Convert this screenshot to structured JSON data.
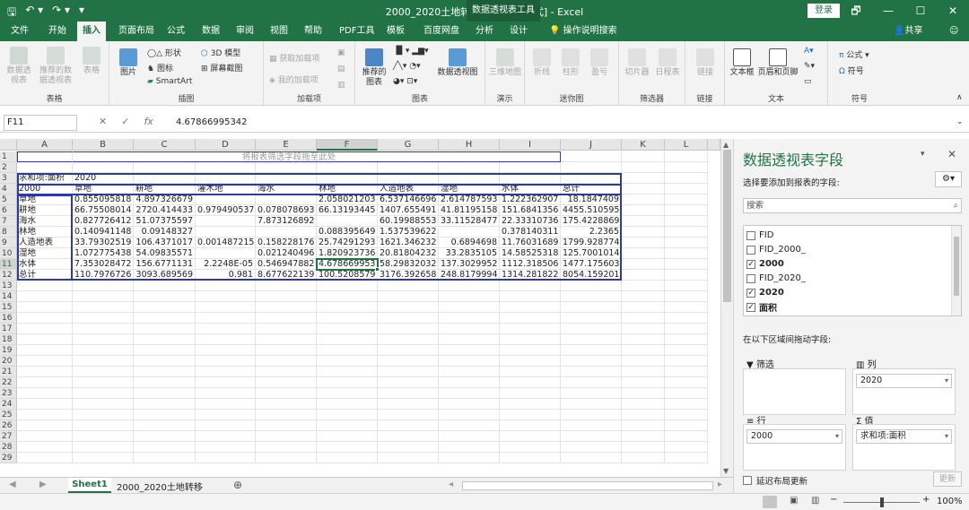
{
  "title": {
    "quick_access": [
      "🖫",
      "↶ ▾",
      "↷ ▾",
      "▾"
    ],
    "window": "2000_2020土地转移.xls [兼容模式] - Excel",
    "context": "数据透视表工具",
    "login": "登录",
    "controls": [
      "🗗",
      "—",
      "☐",
      "✕"
    ]
  },
  "tabs": [
    "文件",
    "开始",
    "插入",
    "页面布局",
    "公式",
    "数据",
    "审阅",
    "视图",
    "帮助",
    "PDF工具",
    "模板",
    "百度网盘",
    "分析",
    "设计",
    "操作说明搜索"
  ],
  "share": "共享",
  "ribbon": {
    "tables": {
      "label": "表格",
      "items": [
        "数据透视表",
        "推荐的数据透视表",
        "表格"
      ]
    },
    "illus": {
      "label": "插图",
      "picture": "图片",
      "shapes": "形状",
      "icons": "图标",
      "smartart": "SmartArt",
      "model3d": "3D 模型",
      "screenshot": "屏幕截图"
    },
    "addins": {
      "label": "加载项",
      "get": "获取加载项",
      "my": "我的加载项"
    },
    "charts": {
      "label": "图表",
      "recommended": "推荐的图表",
      "pivotchart": "数据透视图"
    },
    "tours": {
      "label": "演示",
      "map3d": "三维地图"
    },
    "spark": {
      "label": "迷你图",
      "items": [
        "折线",
        "柱形",
        "盈亏"
      ]
    },
    "filters": {
      "label": "筛选器",
      "items": [
        "切片器",
        "日程表"
      ]
    },
    "links": {
      "label": "链接",
      "item": "链接"
    },
    "text": {
      "label": "文本",
      "items": [
        "文本框",
        "页眉和页脚"
      ]
    },
    "symbols": {
      "label": "符号",
      "formula": "公式",
      "symbol": "符号"
    }
  },
  "formula": {
    "name": "F11",
    "value": "4.67866995342",
    "icons": [
      "✕",
      "✓",
      "fx"
    ]
  },
  "sheet": {
    "columns": [
      "A",
      "B",
      "C",
      "D",
      "E",
      "F",
      "G",
      "H",
      "I",
      "J",
      "K",
      "L"
    ],
    "rows": [
      "1",
      "2",
      "3",
      "4",
      "5",
      "6",
      "7",
      "8",
      "9",
      "10",
      "11",
      "12",
      "13",
      "14",
      "15",
      "16",
      "17",
      "18",
      "19",
      "20",
      "21",
      "22",
      "23",
      "24",
      "25",
      "26",
      "27",
      "28",
      "29"
    ],
    "filter_hint": "将报表筛选字段拖至此处",
    "sum_label": "求和项:面积",
    "col_field": "2020",
    "row_field": "2000",
    "headers": [
      "草地",
      "耕地",
      "灌木地",
      "海水",
      "林地",
      "人造地表",
      "湿地",
      "水体",
      "总计"
    ],
    "data": [
      [
        "草地",
        "0.855095818",
        "4.897326679",
        "",
        "",
        "2.058021203",
        "6.537146696",
        "2.614787593",
        "1.222362907",
        "18.1847409"
      ],
      [
        "耕地",
        "66.75508014",
        "2720.414433",
        "0.979490537",
        "0.078078693",
        "66.13193445",
        "1407.655491",
        "41.81195158",
        "151.6841356",
        "4455.510595"
      ],
      [
        "海水",
        "0.827726412",
        "51.07375597",
        "",
        "7.873126892",
        "",
        "60.19988553",
        "33.11528477",
        "22.33310736",
        "175.4228869"
      ],
      [
        "林地",
        "0.140941148",
        "0.09148327",
        "",
        "",
        "0.088395649",
        "1.537539622",
        "",
        "0.378140311",
        "2.2365"
      ],
      [
        "人造地表",
        "33.79302519",
        "106.4371017",
        "0.001487215",
        "0.158228176",
        "25.74291293",
        "1621.346232",
        "0.6894698",
        "11.76031689",
        "1799.928774"
      ],
      [
        "湿地",
        "1.072775438",
        "54.09835571",
        "",
        "0.021240496",
        "1.820923736",
        "20.81804232",
        "33.2835105",
        "14.58525318",
        "125.7001014"
      ],
      [
        "水体",
        "7.353028472",
        "156.6771131",
        "2.2248E-05",
        "0.546947882",
        "4.678669953",
        "58.29832032",
        "137.3029952",
        "1112.318506",
        "1477.175603"
      ],
      [
        "总计",
        "110.7976726",
        "3093.689569",
        "0.981",
        "8.677622139",
        "100.5208579",
        "3176.392658",
        "248.8179994",
        "1314.281822",
        "8054.159201"
      ]
    ]
  },
  "sheet_tabs": [
    "Sheet1",
    "2000_2020土地转移"
  ],
  "pivot": {
    "title": "数据透视表字段",
    "subtitle": "选择要添加到报表的字段:",
    "search_placeholder": "搜索",
    "fields": [
      {
        "name": "FID",
        "checked": false
      },
      {
        "name": "FID_2000_",
        "checked": false
      },
      {
        "name": "2000",
        "checked": true
      },
      {
        "name": "FID_2020_",
        "checked": false
      },
      {
        "name": "2020",
        "checked": true
      },
      {
        "name": "面积",
        "checked": true
      }
    ],
    "drag_hint": "在以下区域间拖动字段:",
    "zones": {
      "filter": "筛选",
      "columns": "列",
      "rows": "行",
      "values": "值"
    },
    "column_value": "2020",
    "row_value": "2000",
    "value_value": "求和项:面积",
    "defer": "延迟布局更新",
    "update": "更新"
  },
  "status": {
    "zoom": "100%"
  },
  "colors": {
    "accent": "#217346",
    "selection": "#217346",
    "pivot_border": "#2f3a9e"
  }
}
